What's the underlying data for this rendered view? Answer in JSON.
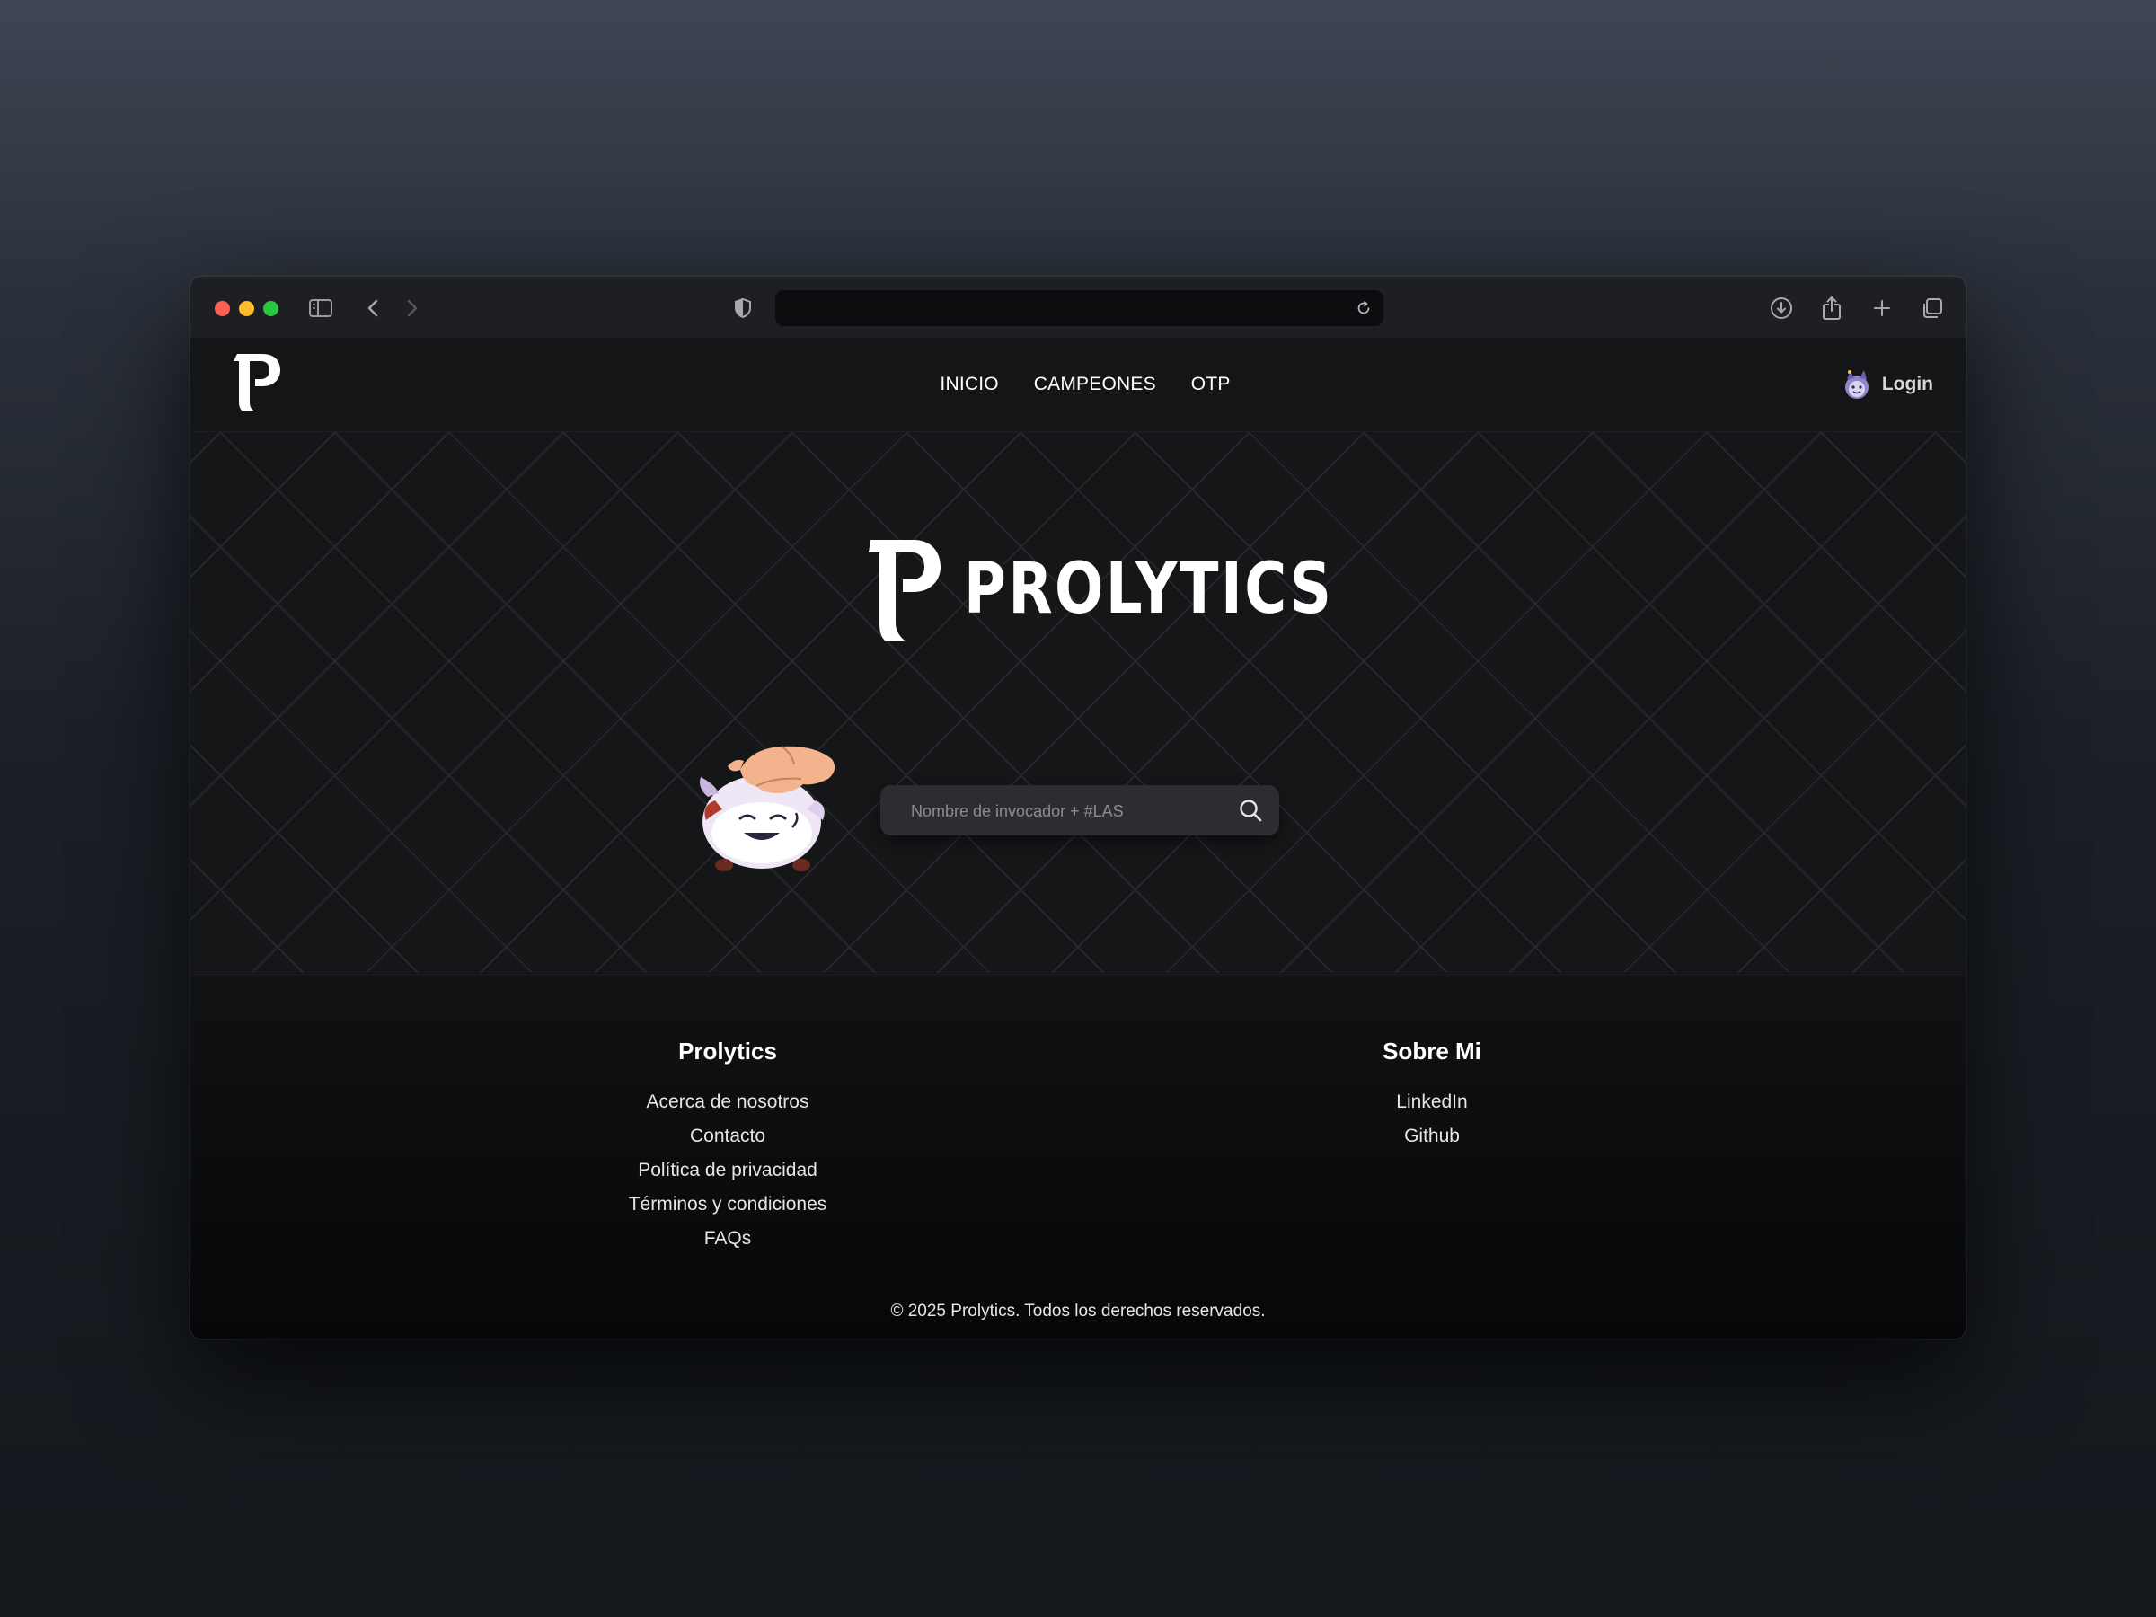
{
  "browser": {
    "address": ""
  },
  "header": {
    "nav": [
      {
        "label": "INICIO"
      },
      {
        "label": "CAMPEONES"
      },
      {
        "label": "OTP"
      }
    ],
    "login_label": "Login"
  },
  "hero": {
    "brand": "PROLYTICS",
    "search_placeholder": "Nombre de invocador + #LAS"
  },
  "footer": {
    "col1": {
      "title": "Prolytics",
      "links": [
        "Acerca de nosotros",
        "Contacto",
        "Política de privacidad",
        "Términos y condiciones",
        "FAQs"
      ]
    },
    "col2": {
      "title": "Sobre Mi",
      "links": [
        "LinkedIn",
        "Github"
      ]
    },
    "copyright": "© 2025 Prolytics. Todos los derechos reservados."
  },
  "icons": {
    "sidebar": "sidebar-icon",
    "back": "chevron-left-icon",
    "forward": "chevron-right-icon",
    "shield": "shield-icon",
    "reload": "reload-icon",
    "download": "download-icon",
    "share": "share-icon",
    "new_tab": "plus-icon",
    "tabs": "tabs-icon",
    "search": "search-icon"
  }
}
